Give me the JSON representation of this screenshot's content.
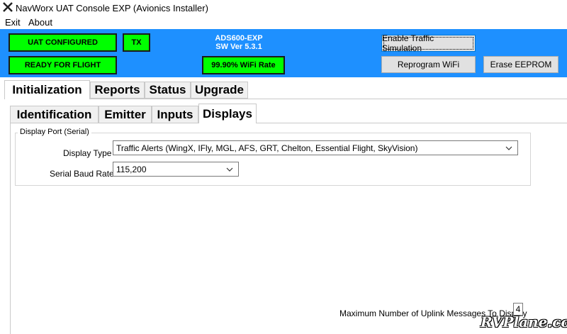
{
  "window": {
    "title": "NavWorx UAT Console EXP (Avionics Installer)",
    "icon": "x-close-icon"
  },
  "menu": {
    "items": [
      "Exit",
      "About"
    ]
  },
  "status": {
    "uat_configured": "UAT CONFIGURED",
    "tx": "TX",
    "ready": "READY FOR FLIGHT",
    "model": "ADS600-EXP",
    "sw_version": "SW Ver 5.3.1",
    "wifi_rate": "99.90% WiFi Rate",
    "indicator_color": "#00ff00",
    "bar_color": "#1e90ff"
  },
  "buttons": {
    "traffic_sim": "Enable Traffic Simulation",
    "reprogram_wifi": "Reprogram WiFi",
    "erase_eeprom": "Erase EEPROM"
  },
  "main_tabs": [
    "Initialization",
    "Reports",
    "Status",
    "Upgrade"
  ],
  "sub_tabs": [
    "Identification",
    "Emitter",
    "Inputs",
    "Displays"
  ],
  "display_port": {
    "legend": "Display Port (Serial)",
    "display_type_label": "Display Type",
    "display_type_value": "Traffic Alerts (WingX, IFly, MGL, AFS, GRT, Chelton, Essential Flight, SkyVision)",
    "baud_label": "Serial Baud Rate",
    "baud_value": "115,200"
  },
  "uplink": {
    "label": "Maximum Number of Uplink Messages To Display",
    "value": "4"
  },
  "watermark": "RVPlane.com"
}
